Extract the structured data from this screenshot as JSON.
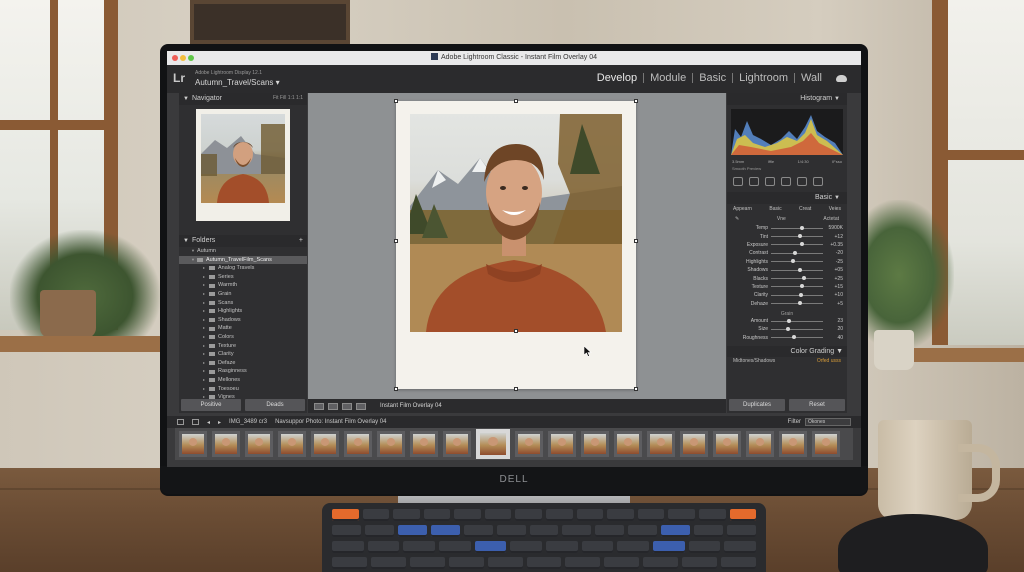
{
  "window": {
    "title": "Adobe Lightroom Classic - Instant Film Overlay 04"
  },
  "identity": {
    "logo": "Lr",
    "subtitle": "Adobe Lightroom Display 12.1",
    "catalog": "Autumn_Travel/Scans ▾"
  },
  "modules": [
    "Develop",
    "Module",
    "Basic",
    "Lightroom",
    "Wall"
  ],
  "navigator": {
    "title": "Navigator",
    "zoom": [
      "Fit",
      "Fill",
      "1:1",
      "1:1"
    ]
  },
  "folders": {
    "title": "Folders",
    "root": "Autumn",
    "selected": "Autumn_TravelFilm_Scans",
    "items": [
      "Analog Travels",
      "Series",
      "Warmth",
      "Grain",
      "Scans",
      "Highlights",
      "Shadows",
      "Matte",
      "Colors",
      "Texture",
      "Clarity",
      "Defaze",
      "Rasginness",
      "Mellones",
      "Toesoeu",
      "Vignes"
    ]
  },
  "left_buttons": {
    "left": "Positive",
    "right": "Deads"
  },
  "center": {
    "preset_label": "Instant Film Overlay 04"
  },
  "histogram": {
    "title": "Histogram",
    "readouts": [
      "3.5mm",
      "Iffle",
      "1/4:30",
      "IFsso"
    ],
    "footer": "Smooth Preview"
  },
  "basic": {
    "title": "Basic",
    "tabs": [
      "Appearn",
      "Basic",
      "Creat",
      "Veies"
    ],
    "wb_labels": [
      "Vne",
      "Actetat"
    ],
    "sliders": [
      {
        "label": "Temp",
        "value": "5900K",
        "pos": 0.55
      },
      {
        "label": "Tint",
        "value": "+12",
        "pos": 0.52
      },
      {
        "label": "Exposure",
        "value": "+0.35",
        "pos": 0.56
      },
      {
        "label": "Contrast",
        "value": "-20",
        "pos": 0.42
      },
      {
        "label": "Highlights",
        "value": "-25",
        "pos": 0.38
      },
      {
        "label": "Shadows",
        "value": "+05",
        "pos": 0.51
      },
      {
        "label": "Blacks",
        "value": "+25",
        "pos": 0.6
      },
      {
        "label": "Texture",
        "value": "+15",
        "pos": 0.56
      },
      {
        "label": "Clarity",
        "value": "+10",
        "pos": 0.54
      },
      {
        "label": "Dehaze",
        "value": "+5",
        "pos": 0.52
      }
    ],
    "grain_title": "Grain",
    "grain": [
      {
        "label": "Amount",
        "value": "23",
        "pos": 0.3
      },
      {
        "label": "Size",
        "value": "20",
        "pos": 0.28
      },
      {
        "label": "Roughness",
        "value": "40",
        "pos": 0.4
      }
    ]
  },
  "color_grading": {
    "title": "Color Grading",
    "left": "Midtones/Shadows",
    "right": "Orfed usss"
  },
  "right_buttons": {
    "left": "Duplicates",
    "right": "Reset"
  },
  "filmstrip_bar": {
    "count": "IMG_3489 cr3",
    "path": "Navsuppor Photo: Instant Film Overlay 04",
    "filter_label": "Filter",
    "filter_value": "Okones"
  },
  "brand": "DELL",
  "colors": {
    "accent_orange": "#d69b38",
    "panel_bg": "#2f2f31",
    "sweater": "#a34e2a"
  }
}
